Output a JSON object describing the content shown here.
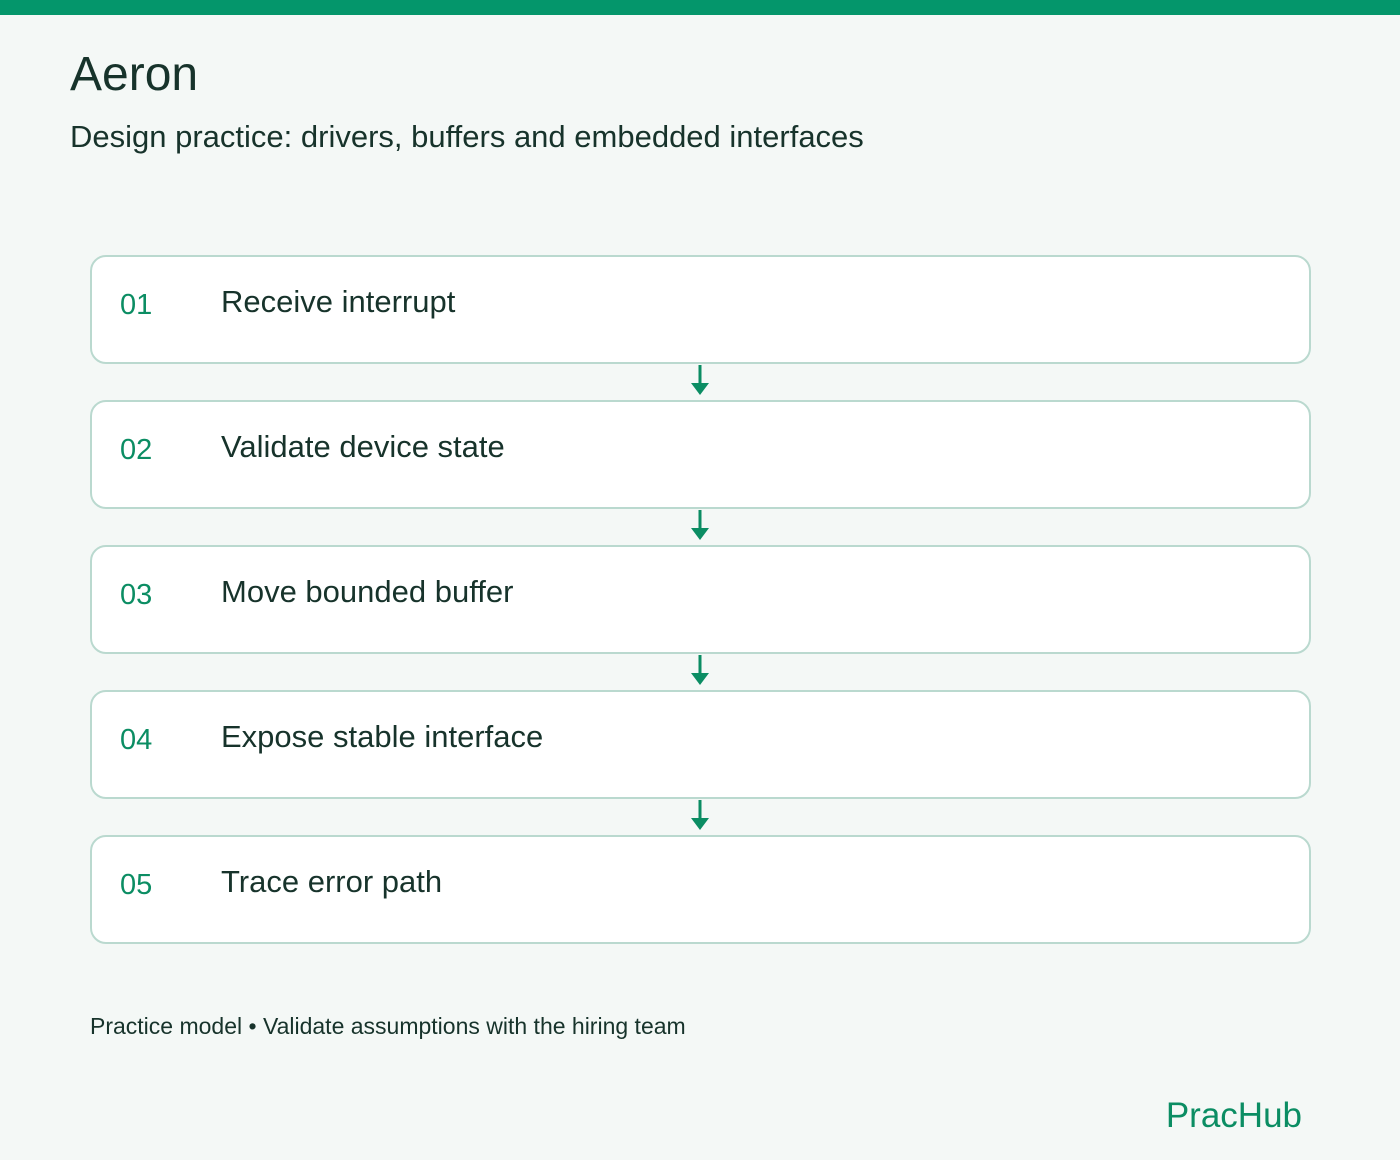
{
  "header": {
    "title": "Aeron",
    "subtitle": "Design practice: drivers, buffers and embedded interfaces"
  },
  "steps": [
    {
      "number": "01",
      "label": "Receive interrupt"
    },
    {
      "number": "02",
      "label": "Validate device state"
    },
    {
      "number": "03",
      "label": "Move bounded buffer"
    },
    {
      "number": "04",
      "label": "Expose stable interface"
    },
    {
      "number": "05",
      "label": "Trace error path"
    }
  ],
  "footer": {
    "note": "Practice model • Validate assumptions with the hiring team",
    "brand": "PracHub"
  },
  "colors": {
    "accent": "#04966b",
    "text": "#17332b",
    "card_border": "#bad9cf",
    "background": "#f4f8f6"
  },
  "icons": {
    "connector": "arrow-down-icon"
  }
}
